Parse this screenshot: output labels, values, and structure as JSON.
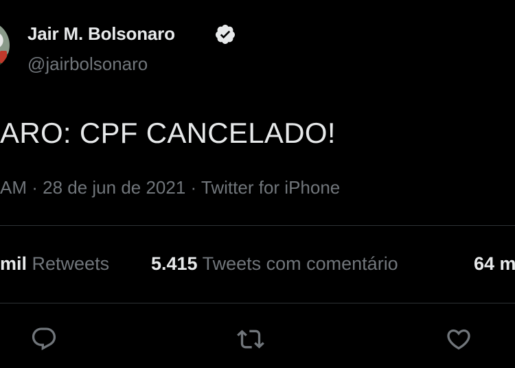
{
  "author": {
    "name": "Jair M. Bolsonaro",
    "handle": "@jairbolsonaro",
    "verified_icon": "verified-badge-icon"
  },
  "tweet": {
    "text": "ARO: CPF CANCELADO!",
    "meta": "AM · 28 de jun de 2021 · Twitter for iPhone"
  },
  "stats": {
    "retweets": {
      "number": "mil",
      "label": "Retweets"
    },
    "quotes": {
      "number": "5.415",
      "label": "Tweets com comentário"
    },
    "likes": {
      "number": "64 m",
      "label": ""
    }
  },
  "actions": {
    "reply_icon": "reply-icon",
    "retweet_icon": "retweet-icon",
    "like_icon": "heart-icon"
  },
  "colors": {
    "background": "#000000",
    "primary_text": "#e7e9ea",
    "secondary_text": "#71767b",
    "divider": "#2f3336"
  }
}
